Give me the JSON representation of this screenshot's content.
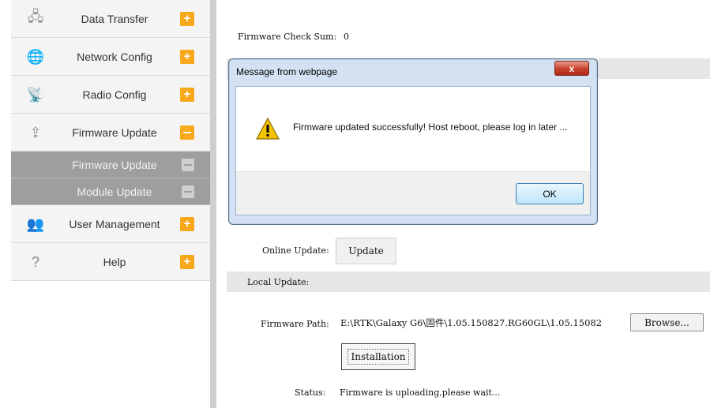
{
  "sidebar": {
    "items": [
      {
        "label": "Data Transfer",
        "icon": "data-transfer-icon",
        "glyph": "🖧"
      },
      {
        "label": "Network Config",
        "icon": "globe-icon",
        "glyph": "🌐"
      },
      {
        "label": "Radio Config",
        "icon": "radio-tower-icon",
        "glyph": "📡"
      },
      {
        "label": "Firmware Update",
        "icon": "upload-icon",
        "glyph": "⇪"
      },
      {
        "label": "User Management",
        "icon": "users-icon",
        "glyph": "👥"
      },
      {
        "label": "Help",
        "icon": "help-icon",
        "glyph": "?"
      }
    ],
    "subitems": [
      {
        "label": "Firmware Update"
      },
      {
        "label": "Module Update"
      }
    ],
    "plus_symbol": "+",
    "accent_color": "#f7a81b"
  },
  "main": {
    "checksum_label": "Firmware Check Sum:",
    "checksum_value": "0",
    "online_update_label": "Online Update:",
    "update_button": "Update",
    "local_update_label": "Local Update:",
    "firmware_path_label": "Firmware Path:",
    "firmware_path_value": "E:\\RTK\\Galaxy G6\\固件\\1.05.150827.RG60GL\\1.05.15082",
    "browse_button": "Browse...",
    "install_button": "Installation",
    "status_label": "Status:",
    "status_value": "Firmware is uploading,please wait..."
  },
  "dialog": {
    "title": "Message from webpage",
    "close_symbol": "x",
    "message": "Firmware updated successfully! Host reboot, please log in later ...",
    "ok_button": "OK",
    "icon": "warning-icon"
  }
}
